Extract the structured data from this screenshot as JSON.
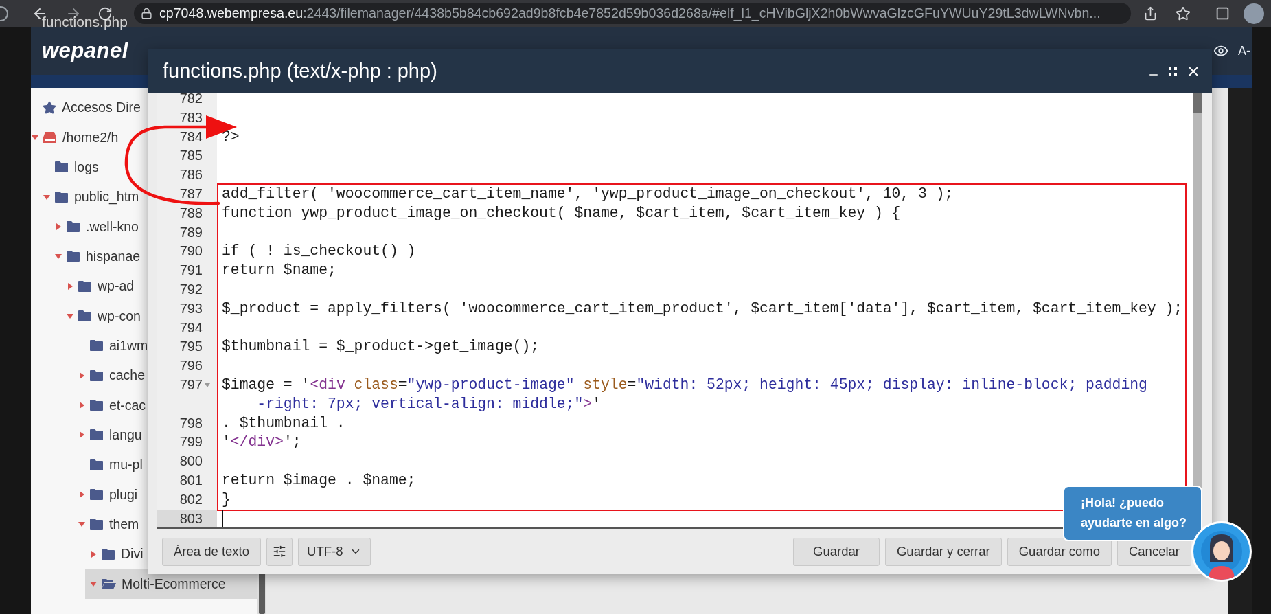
{
  "video_title": "functions.php",
  "browser": {
    "url_host": "cp7048.webempresa.eu",
    "url_path": ":2443/filemanager/4438b5b84cb692ad9b8fcb4e7852d59b036d268a/#elf_l1_cHVibGljX2h0bWwvaGlzcGFuYWUuY29tL3dwLWNvbn..."
  },
  "header": {
    "logo": "wepanel",
    "font_label": "A-"
  },
  "sidebar": {
    "items": [
      {
        "label": "Accesos Dire",
        "kind": "star",
        "expandable": false,
        "selected": false
      },
      {
        "label": "/home2/h",
        "kind": "drive",
        "expandable": true,
        "expanded": true,
        "selected": false,
        "children": [
          {
            "label": "logs",
            "kind": "folder",
            "expandable": false,
            "selected": false
          },
          {
            "label": "public_htm",
            "kind": "folder",
            "expandable": true,
            "expanded": true,
            "selected": false,
            "children": [
              {
                "label": ".well-kno",
                "kind": "folder",
                "expandable": true,
                "expanded": false,
                "selected": false
              },
              {
                "label": "hispanae",
                "kind": "folder",
                "expandable": true,
                "expanded": true,
                "selected": false,
                "children": [
                  {
                    "label": "wp-ad",
                    "kind": "folder",
                    "expandable": true,
                    "expanded": false,
                    "selected": false
                  },
                  {
                    "label": "wp-con",
                    "kind": "folder",
                    "expandable": true,
                    "expanded": true,
                    "selected": false,
                    "children": [
                      {
                        "label": "ai1wm",
                        "kind": "folder",
                        "expandable": false,
                        "selected": false
                      },
                      {
                        "label": "cache",
                        "kind": "folder",
                        "expandable": true,
                        "expanded": false,
                        "selected": false
                      },
                      {
                        "label": "et-cac",
                        "kind": "folder",
                        "expandable": true,
                        "expanded": false,
                        "selected": false
                      },
                      {
                        "label": "langu",
                        "kind": "folder",
                        "expandable": true,
                        "expanded": false,
                        "selected": false
                      },
                      {
                        "label": "mu-pl",
                        "kind": "folder",
                        "expandable": false,
                        "selected": false
                      },
                      {
                        "label": "plugi",
                        "kind": "folder",
                        "expandable": true,
                        "expanded": false,
                        "selected": false
                      },
                      {
                        "label": "them",
                        "kind": "folder",
                        "expandable": true,
                        "expanded": true,
                        "selected": false,
                        "children": [
                          {
                            "label": "Divi",
                            "kind": "folder",
                            "expandable": true,
                            "expanded": false,
                            "selected": false
                          },
                          {
                            "label": "Molti-Ecommerce",
                            "kind": "folder",
                            "expandable": true,
                            "expanded": true,
                            "selected": true
                          }
                        ]
                      }
                    ]
                  }
                ]
              }
            ]
          }
        ]
      }
    ]
  },
  "dialog": {
    "title": "functions.php (text/x-php : php)",
    "lines": [
      {
        "number": "782",
        "boxed": false,
        "current": false,
        "foldable": false
      },
      {
        "number": "783",
        "boxed": false,
        "current": false,
        "foldable": false
      },
      {
        "number": "784",
        "boxed": false,
        "current": false,
        "foldable": false,
        "segments": [
          {
            "text": "?>",
            "kind": "plain"
          }
        ]
      },
      {
        "number": "785",
        "boxed": false,
        "current": false,
        "foldable": false
      },
      {
        "number": "786",
        "boxed": false,
        "current": false,
        "foldable": false
      },
      {
        "number": "787",
        "boxed": true,
        "current": false,
        "foldable": false,
        "segments": [
          {
            "text": "add_filter( 'woocommerce_cart_item_name', 'ywp_product_image_on_checkout', 10, 3 );",
            "kind": "plain"
          }
        ]
      },
      {
        "number": "788",
        "boxed": true,
        "current": false,
        "foldable": false,
        "segments": [
          {
            "text": "function ywp_product_image_on_checkout( $name, $cart_item, $cart_item_key ) {",
            "kind": "plain"
          }
        ]
      },
      {
        "number": "789",
        "boxed": true,
        "current": false,
        "foldable": false
      },
      {
        "number": "790",
        "boxed": true,
        "current": false,
        "foldable": false,
        "segments": [
          {
            "text": "if ( ! is_checkout() )",
            "kind": "plain"
          }
        ]
      },
      {
        "number": "791",
        "boxed": true,
        "current": false,
        "foldable": false,
        "segments": [
          {
            "text": "return $name;",
            "kind": "plain"
          }
        ]
      },
      {
        "number": "792",
        "boxed": true,
        "current": false,
        "foldable": false
      },
      {
        "number": "793",
        "boxed": true,
        "current": false,
        "foldable": false,
        "segments": [
          {
            "text": "$_product = apply_filters( 'woocommerce_cart_item_product', $cart_item['data'], $cart_item, $cart_item_key );",
            "kind": "plain"
          }
        ]
      },
      {
        "number": "794",
        "boxed": true,
        "current": false,
        "foldable": false
      },
      {
        "number": "795",
        "boxed": true,
        "current": false,
        "foldable": false,
        "segments": [
          {
            "text": "$thumbnail = $_product->get_image();",
            "kind": "plain"
          }
        ]
      },
      {
        "number": "796",
        "boxed": true,
        "current": false,
        "foldable": false
      },
      {
        "number": "797",
        "boxed": true,
        "current": false,
        "foldable": true,
        "segments": [
          {
            "text": "$image = '",
            "kind": "plain"
          },
          {
            "text": "<div",
            "kind": "tag"
          },
          {
            "text": " class",
            "kind": "attr"
          },
          {
            "text": "=",
            "kind": "plain"
          },
          {
            "text": "\"ywp-product-image\"",
            "kind": "string"
          },
          {
            "text": " style",
            "kind": "attr"
          },
          {
            "text": "=",
            "kind": "plain"
          },
          {
            "text": "\"width: 52px; height: 45px; display: inline-block; padding",
            "kind": "string"
          }
        ],
        "wrap": [
          {
            "text": "-right: 7px; vertical-align: middle;\"",
            "kind": "string"
          },
          {
            "text": ">",
            "kind": "tag"
          },
          {
            "text": "'",
            "kind": "plain"
          }
        ]
      },
      {
        "number": "798",
        "boxed": true,
        "current": false,
        "foldable": false,
        "segments": [
          {
            "text": ". $thumbnail .",
            "kind": "plain"
          }
        ]
      },
      {
        "number": "799",
        "boxed": true,
        "current": false,
        "foldable": false,
        "segments": [
          {
            "text": "'",
            "kind": "plain"
          },
          {
            "text": "</div>",
            "kind": "tag"
          },
          {
            "text": "';",
            "kind": "plain"
          }
        ]
      },
      {
        "number": "800",
        "boxed": true,
        "current": false,
        "foldable": false
      },
      {
        "number": "801",
        "boxed": true,
        "current": false,
        "foldable": false,
        "segments": [
          {
            "text": "return $image . $name;",
            "kind": "plain"
          }
        ]
      },
      {
        "number": "802",
        "boxed": true,
        "current": false,
        "foldable": false,
        "segments": [
          {
            "text": "}",
            "kind": "plain"
          }
        ]
      },
      {
        "number": "803",
        "boxed": false,
        "current": true,
        "foldable": false
      }
    ],
    "footer": {
      "mode_button": "Área de texto",
      "encoding": "UTF-8",
      "buttons": [
        "Guardar",
        "Guardar y cerrar",
        "Guardar como",
        "Cancelar"
      ]
    }
  },
  "chat": {
    "message": "¡Hola! ¿puedo ayudarte en algo?"
  }
}
